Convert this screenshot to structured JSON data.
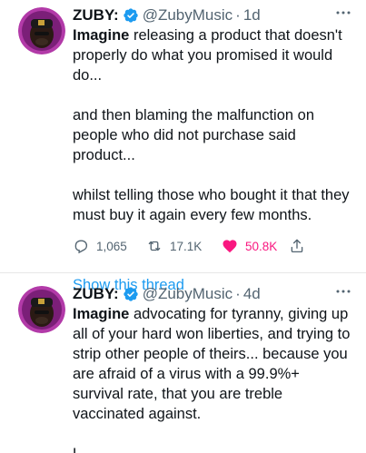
{
  "tweets": [
    {
      "name": "ZUBY:",
      "handle": "@ZubyMusic",
      "dot": "·",
      "time": "1d",
      "para1_bold": "Imagine",
      "para1_rest": " releasing a product that doesn't properly do what you promised it would do...",
      "para2": "and then blaming the malfunction on people who did not purchase said product...",
      "para3": "whilst telling those who bought it that they must buy it again every few months.",
      "replies": "1,065",
      "retweets": "17.1K",
      "likes": "50.8K",
      "show_thread": "Show this thread"
    },
    {
      "name": "ZUBY:",
      "handle": "@ZubyMusic",
      "dot": "·",
      "time": "4d",
      "para1_bold": "Imagine",
      "para1_rest": " advocating for tyranny, giving up all of your hard won liberties, and trying to strip other people of theirs... because you are afraid of a virus with a 99.9%+ survival rate, that you are treble vaccinated against.",
      "para2": "L."
    }
  ],
  "colors": {
    "accent": "#1d9bf0",
    "like": "#f91880",
    "muted": "#536471",
    "text": "#0f1419"
  },
  "icons": [
    "avatar",
    "verified-badge-icon",
    "more-icon",
    "reply-icon",
    "retweet-icon",
    "heart-icon",
    "share-icon"
  ]
}
